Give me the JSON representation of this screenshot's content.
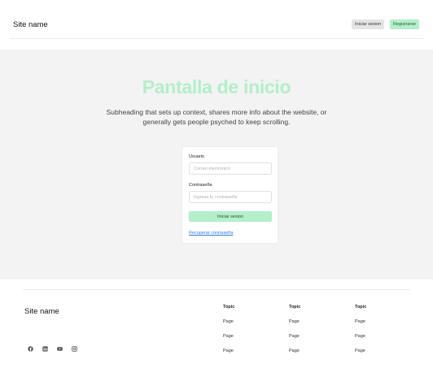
{
  "header": {
    "site_name": "Site name",
    "login_label": "Iniciar sesion",
    "register_label": "Registrarse"
  },
  "hero": {
    "title": "Pantalla de inicio",
    "subtitle": "Subheading that sets up context, shares more info about the website, or generally gets people psyched to keep scrolling."
  },
  "login_form": {
    "user_label": "Usuario",
    "user_placeholder": "Correo electronico",
    "password_label": "Contraseña",
    "password_placeholder": "Ingresa tu contraseña",
    "submit_label": "Iniciar sesion",
    "forgot_label": "Recuperar contraseña"
  },
  "footer": {
    "site_name": "Site name",
    "social_icons": [
      "facebook-icon",
      "linkedin-icon",
      "youtube-icon",
      "instagram-icon"
    ],
    "columns": [
      {
        "topic": "Topic",
        "pages": [
          "Page",
          "Page",
          "Page"
        ]
      },
      {
        "topic": "Topic",
        "pages": [
          "Page",
          "Page",
          "Page"
        ]
      },
      {
        "topic": "Topic",
        "pages": [
          "Page",
          "Page",
          "Page"
        ]
      }
    ]
  },
  "colors": {
    "accent": "#b3efc8",
    "hero_background": "#f3f3f3",
    "link": "#2b7de9"
  }
}
